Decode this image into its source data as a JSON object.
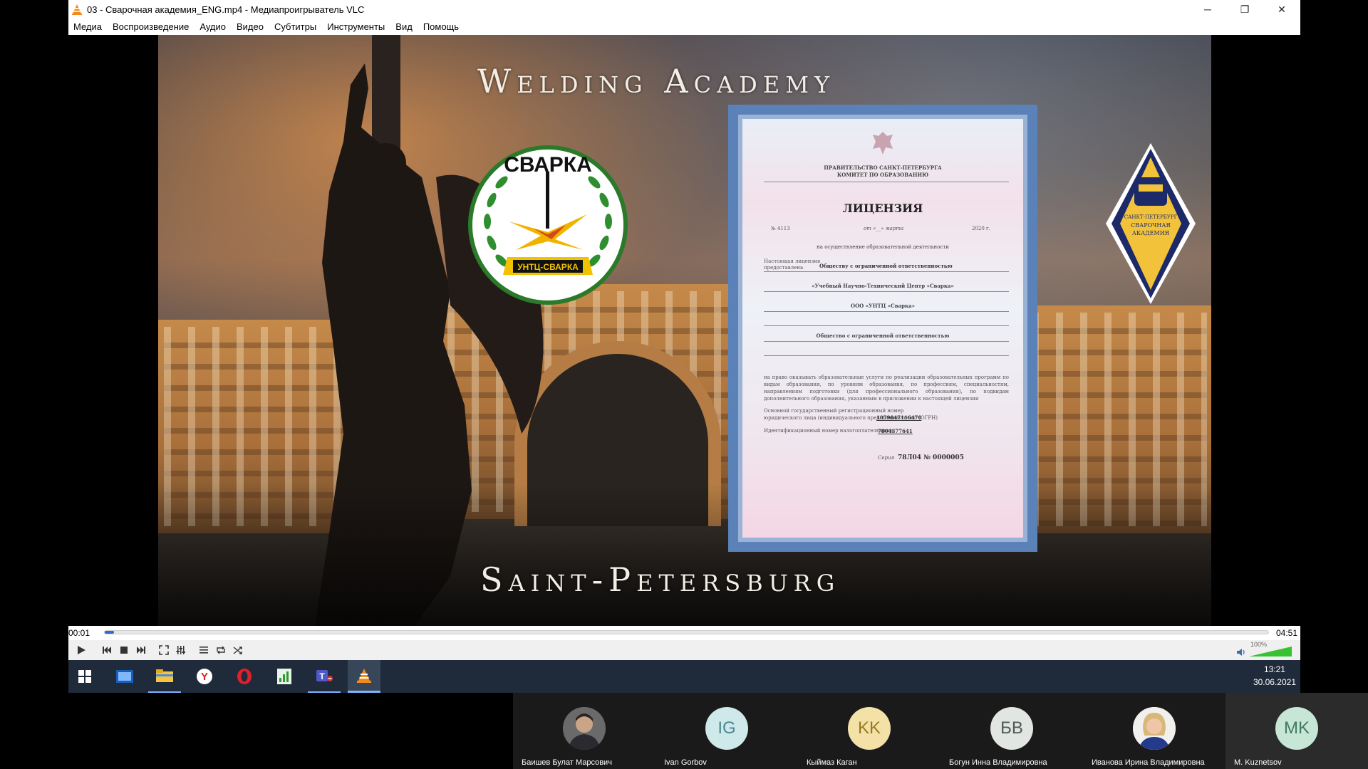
{
  "window": {
    "title": "03 - Сварочная академия_ENG.mp4 - Медиапроигрыватель VLC",
    "minimize": "─",
    "restore": "❐",
    "close": "✕"
  },
  "menu": [
    "Медиа",
    "Воспроизведение",
    "Аудио",
    "Видео",
    "Субтитры",
    "Инструменты",
    "Вид",
    "Помощь"
  ],
  "video": {
    "headline_top": "Welding Academy",
    "headline_bottom": "Saint-Petersburg",
    "logo_left": {
      "arc_text": "СВАРКА",
      "ribbon_text": "УНТЦ-СВАРКА"
    },
    "logo_right": {
      "lines": [
        "САНКТ-ПЕТЕРБУРГ",
        "СВАРОЧНАЯ",
        "АКАДЕМИЯ"
      ]
    },
    "license": {
      "issuer_line1": "ПРАВИТЕЛЬСТВО САНКТ-ПЕТЕРБУРГА",
      "issuer_line2": "КОМИТЕТ ПО ОБРАЗОВАНИЮ",
      "heading": "ЛИЦЕНЗИЯ",
      "number_label": "№",
      "number": "4113",
      "date": "от «__» марта",
      "year": "2020 г.",
      "purpose": "на осуществление образовательной деятельности",
      "provided_label1": "Настоящая лицензия",
      "provided_label2": "предоставлена",
      "org_form": "Обществу с ограниченной ответственностью",
      "org_name": "«Учебный Научно-Технический Центр «Сварка»",
      "org_short": "ООО «УНТЦ «Сварка»",
      "org_form2": "Общество с ограниченной ответственностью",
      "rights_text": "на право оказывать образовательные услуги по реализации образовательных программ по видам образования, по уровням образования, по профессиям, специальностям, направлениям подготовки (для профессионального образования), по подвидам дополнительного образования, указанным в приложении к настоящей лицензии",
      "ogrn_label": "Основной государственный регистрационный номер юридического лица (индивидуального предпринимателя) (ОГРН)",
      "ogrn": "1079847116470",
      "inn_label": "Идентификационный номер налогоплательщика",
      "inn": "7804377641",
      "series_label": "Серия",
      "series": "78Л04 № 0000005"
    }
  },
  "player": {
    "time_elapsed": "00:01",
    "time_total": "04:51",
    "progress": 0.004,
    "volume_label": "100%",
    "volume": 1.0,
    "accent": "#2c6fd1",
    "volume_color": "#37c331"
  },
  "taskbar": {
    "icons": [
      "windows-start-icon",
      "screen-app-icon",
      "file-explorer-icon",
      "yandex-browser-icon",
      "opera-icon",
      "chart-app-icon",
      "teams-icon",
      "vlc-icon"
    ],
    "time": "13:21",
    "date": "30.06.2021"
  },
  "participants": [
    {
      "name": "Баишев Булат Марсович",
      "initials": "",
      "photo": true,
      "bg": "#3a3a3a",
      "fg": "#fff"
    },
    {
      "name": "Ivan Gorbov",
      "initials": "IG",
      "photo": false,
      "bg": "#cfe8ea",
      "fg": "#4a8a92"
    },
    {
      "name": "Кыймаз Каган",
      "initials": "KK",
      "photo": false,
      "bg": "#f3e1a8",
      "fg": "#9a7a20"
    },
    {
      "name": "Богун Инна Владимировна",
      "initials": "БВ",
      "photo": false,
      "bg": "#e1e6e3",
      "fg": "#4d5a52"
    },
    {
      "name": "Иванова Ирина Владимировна",
      "initials": "",
      "photo": true,
      "bg": "#e8e2dc",
      "fg": "#fff"
    },
    {
      "name": "M. Kuznetsov",
      "initials": "MK",
      "photo": false,
      "bg": "#c7e6d6",
      "fg": "#3f7d5c"
    }
  ]
}
